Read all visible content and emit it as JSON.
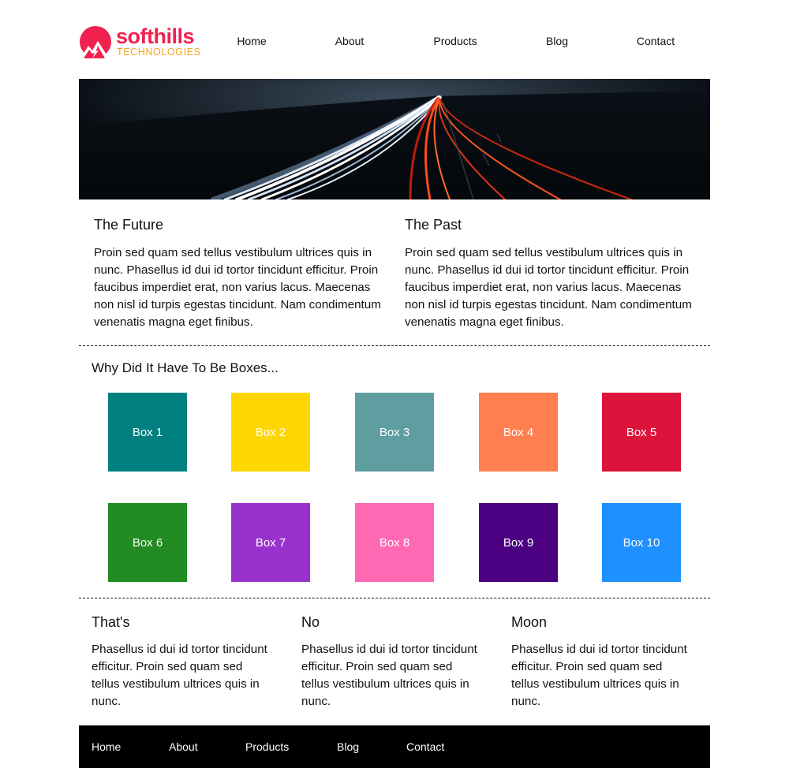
{
  "brand": {
    "name": "softhills",
    "tagline": "TECHNOLOGIES",
    "primary_color": "#f0214f",
    "secondary_color": "#f5a623"
  },
  "nav": {
    "items": [
      "Home",
      "About",
      "Products",
      "Blog",
      "Contact"
    ]
  },
  "hero": {
    "image": "night highway light trails"
  },
  "intro": {
    "left": {
      "title": "The Future",
      "body": "Proin sed quam sed tellus vestibulum ultrices quis in nunc. Phasellus id dui id tortor tincidunt efficitur. Proin faucibus imperdiet erat, non varius lacus. Maecenas non nisl id turpis egestas tincidunt. Nam condimentum venenatis magna eget finibus."
    },
    "right": {
      "title": "The Past",
      "body": "Proin sed quam sed tellus vestibulum ultrices quis in nunc. Phasellus id dui id tortor tincidunt efficitur. Proin faucibus imperdiet erat, non varius lacus. Maecenas non nisl id turpis egestas tincidunt. Nam condimentum venenatis magna eget finibus."
    }
  },
  "boxes": {
    "heading": "Why Did It Have To Be Boxes...",
    "items": [
      {
        "label": "Box 1",
        "color": "#008080"
      },
      {
        "label": "Box 2",
        "color": "#ffd700"
      },
      {
        "label": "Box 3",
        "color": "#5f9ea0"
      },
      {
        "label": "Box 4",
        "color": "#ff7f50"
      },
      {
        "label": "Box 5",
        "color": "#dc143c"
      },
      {
        "label": "Box 6",
        "color": "#228b22"
      },
      {
        "label": "Box 7",
        "color": "#9932cc"
      },
      {
        "label": "Box 8",
        "color": "#ff69b4"
      },
      {
        "label": "Box 9",
        "color": "#4b0082"
      },
      {
        "label": "Box 10",
        "color": "#1e90ff"
      }
    ]
  },
  "features": [
    {
      "title": "That's",
      "body": "Phasellus id dui id tortor tincidunt efficitur. Proin sed quam sed tellus vestibulum ultrices quis in nunc."
    },
    {
      "title": "No",
      "body": "Phasellus id dui id tortor tincidunt efficitur. Proin sed quam sed tellus vestibulum ultrices quis in nunc."
    },
    {
      "title": "Moon",
      "body": "Phasellus id dui id tortor tincidunt efficitur. Proin sed quam sed tellus vestibulum ultrices quis in nunc."
    }
  ],
  "footer": {
    "items": [
      "Home",
      "About",
      "Products",
      "Blog",
      "Contact"
    ]
  }
}
